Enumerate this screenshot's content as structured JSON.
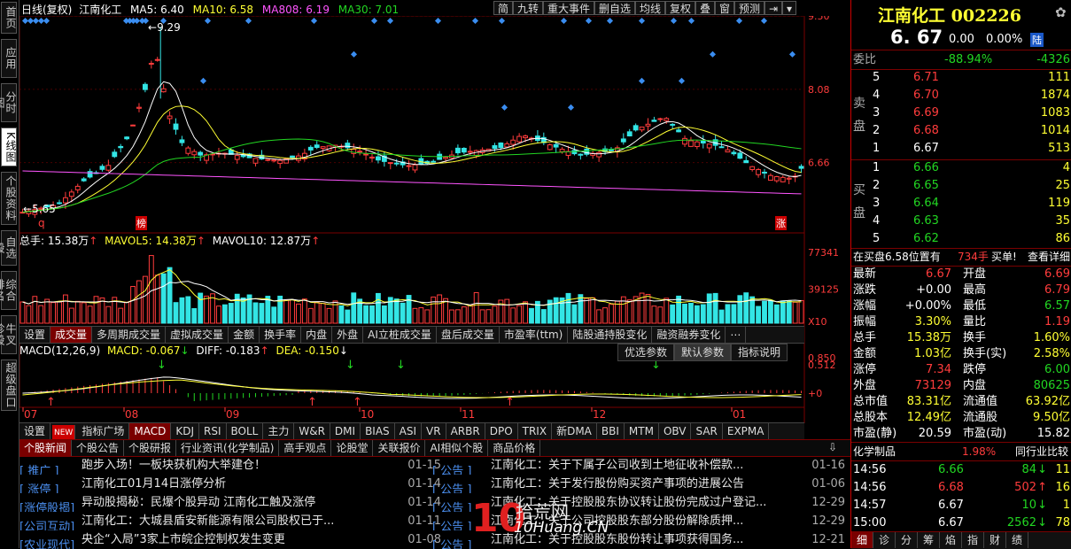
{
  "left_tabs": [
    {
      "label": "首页"
    },
    {
      "label": "应用"
    },
    {
      "label": "分时图"
    },
    {
      "label": "K线图",
      "active": true
    },
    {
      "label": "个股资料"
    },
    {
      "label": "自选股"
    },
    {
      "label": "综合排名"
    },
    {
      "label": "牛叉诊股"
    },
    {
      "label": "超级盘口"
    }
  ],
  "chart_header": {
    "period": "日线(复权)",
    "name": "江南化工",
    "ma5": "MA5: 6.40",
    "ma10": "MA10: 6.58",
    "ma808": "MA808: 6.19",
    "ma30": "MA30: 7.01"
  },
  "toolbar": [
    "简",
    "九转",
    "重大事件",
    "删自选",
    "均线",
    "复权",
    "叠",
    "窗",
    "预测"
  ],
  "price_axis": [
    "9.50",
    "8.08",
    "6.66"
  ],
  "annotations": {
    "high": "9.29",
    "low": "5.65",
    "q": "q",
    "bang": "榜",
    "zhang": "涨"
  },
  "volume_header": {
    "total": "总手: 15.38万",
    "mavol5": "MAVOL5: 14.38万",
    "mavol10": "MAVOL10: 12.87万"
  },
  "volume_axis": [
    "77341",
    "39125",
    "X10"
  ],
  "indicator_tabs": [
    "设置",
    "成交量",
    "多周期成交量",
    "虚拟成交量",
    "金额",
    "换手率",
    "内盘",
    "外盘",
    "AI立桩成交量",
    "盘后成交量",
    "市盈率(ttm)",
    "陆股通持股变化",
    "融资融券变化",
    "⋯"
  ],
  "macd_header": {
    "name": "MACD(12,26,9)",
    "macd": "MACD: -0.067",
    "diff": "DIFF: -0.183",
    "dea": "DEA: -0.150"
  },
  "macd_buttons": [
    "优选参数",
    "默认参数",
    "指标说明"
  ],
  "macd_axis": [
    "0.850",
    "0.512",
    "+0"
  ],
  "month_axis": [
    "07",
    "08",
    "09",
    "10",
    "11",
    "12",
    "01"
  ],
  "index_tabs": [
    "设置",
    "NEW",
    "指标广场",
    "MACD",
    "KDJ",
    "RSI",
    "BOLL",
    "主力",
    "W&R",
    "DMI",
    "BIAS",
    "ASI",
    "VR",
    "ARBR",
    "DPO",
    "TRIX",
    "新DMA",
    "BBI",
    "MTM",
    "OBV",
    "SAR",
    "EXPMA"
  ],
  "news_tabs": [
    "个股新闻",
    "个股公告",
    "个股研报",
    "行业资讯(化学制品)",
    "高手观点",
    "论股堂",
    "关联报价",
    "AI相似个股",
    "商品价格"
  ],
  "news_left": [
    {
      "tag": "[ 推广 ]",
      "title": "跑步入场！一板块获机构大举建仓！",
      "date": "01-15"
    },
    {
      "tag": "[ 涨停 ]",
      "title": "江南化工01月14日涨停分析",
      "date": "01-14"
    },
    {
      "tag": "[涨停股揭]",
      "title": "异动股揭秘：民爆个股异动 江南化工触及涨停",
      "date": "01-14"
    },
    {
      "tag": "[公司互动]",
      "title": "江南化工：大城县盾安新能源有限公司股权已于...",
      "date": "01-11"
    },
    {
      "tag": "[农业现代]",
      "title": "央企“入局”3家上市皖企控制权发生变更",
      "date": "01-08"
    }
  ],
  "news_right": [
    {
      "tag": "[ 公告 ]",
      "title": "江南化工：关于下属子公司收到土地征收补偿款...",
      "date": "01-16"
    },
    {
      "tag": "[ 公告 ]",
      "title": "江南化工：关于发行股份购买资产事项的进展公告",
      "date": "01-06"
    },
    {
      "tag": "[ 公告 ]",
      "title": "江南化工：关于控股股东协议转让股份完成过户登记...",
      "date": "12-29"
    },
    {
      "tag": "[ 公告 ]",
      "title": "江南化工：关于公司控股股东部分股份解除质押...",
      "date": "12-29"
    },
    {
      "tag": "[ 公告 ]",
      "title": "江南化工：关于控股股东股份转让事项获得国务...",
      "date": "12-21"
    }
  ],
  "watermark": {
    "brand": "10",
    "cn": "拾荒网",
    "url": "10Huang.CN"
  },
  "quote": {
    "name": "江南化工",
    "code": "002226",
    "price": "6. 67",
    "change": "0.00",
    "pct": "0.00%",
    "board": "陆",
    "weibi_label": "委比",
    "weibi_pct": "-88.94%",
    "weibi_val": "-4326",
    "sell_label": "卖盘",
    "buy_label": "买盘",
    "asks": [
      {
        "lvl": "5",
        "px": "6.71",
        "vol": "111"
      },
      {
        "lvl": "4",
        "px": "6.70",
        "vol": "1874"
      },
      {
        "lvl": "3",
        "px": "6.69",
        "vol": "1083"
      },
      {
        "lvl": "2",
        "px": "6.68",
        "vol": "1014"
      },
      {
        "lvl": "1",
        "px": "6.67",
        "vol": "513"
      }
    ],
    "bids": [
      {
        "lvl": "1",
        "px": "6.66",
        "vol": "4"
      },
      {
        "lvl": "2",
        "px": "6.65",
        "vol": "25"
      },
      {
        "lvl": "3",
        "px": "6.64",
        "vol": "119"
      },
      {
        "lvl": "4",
        "px": "6.63",
        "vol": "35"
      },
      {
        "lvl": "5",
        "px": "6.62",
        "vol": "86"
      }
    ],
    "buy_pos": "在买盘6.58位置有",
    "buy_qty": "734手",
    "buy_tag": "买单!",
    "detail": "查看详细",
    "stats": [
      [
        "最新",
        "6.67",
        "red",
        "开盘",
        "6.69",
        "red"
      ],
      [
        "涨跌",
        "+0.00",
        "wht",
        "最高",
        "6.79",
        "red"
      ],
      [
        "涨幅",
        "+0.00%",
        "wht",
        "最低",
        "6.57",
        "grn"
      ],
      [
        "振幅",
        "3.30%",
        "yel",
        "量比",
        "1.19",
        "red"
      ],
      [
        "总手",
        "15.38万",
        "yel",
        "换手",
        "1.60%",
        "yel"
      ],
      [
        "金额",
        "1.03亿",
        "yel",
        "换手(实)",
        "2.58%",
        "yel"
      ],
      [
        "涨停",
        "7.34",
        "red",
        "跌停",
        "6.00",
        "grn"
      ],
      [
        "外盘",
        "73129",
        "red",
        "内盘",
        "80625",
        "grn"
      ],
      [
        "总市值",
        "83.31亿",
        "yel",
        "流通值",
        "63.92亿",
        "yel"
      ],
      [
        "总股本",
        "12.49亿",
        "yel",
        "流通股",
        "9.50亿",
        "yel"
      ],
      [
        "市盈(静)",
        "20.59",
        "wht",
        "市盈(动)",
        "15.82",
        "wht"
      ]
    ],
    "industry": "化学制品",
    "industry_pct": "1.98%",
    "industry_link": "同行业比较",
    "ticks": [
      {
        "t": "14:56",
        "px": "6.66",
        "pc": "grn",
        "v": "84",
        "dir": "down",
        "n": "11"
      },
      {
        "t": "14:56",
        "px": "6.68",
        "pc": "red",
        "v": "502",
        "dir": "up",
        "n": "16"
      },
      {
        "t": "14:57",
        "px": "6.67",
        "pc": "wht",
        "v": "10",
        "dir": "down",
        "n": "1"
      },
      {
        "t": "15:00",
        "px": "6.67",
        "pc": "wht",
        "v": "2562",
        "dir": "down",
        "n": "78"
      }
    ],
    "bottom_tabs": [
      "细",
      "诊",
      "分",
      "筹",
      "焰",
      "指",
      "财",
      "绩"
    ]
  },
  "colors": {
    "up": "#ff3c3c",
    "down": "#33e5e5",
    "ma5": "#ffffff",
    "ma10": "#ffff33",
    "ma808": "#ff55ff",
    "ma30": "#22d622"
  }
}
